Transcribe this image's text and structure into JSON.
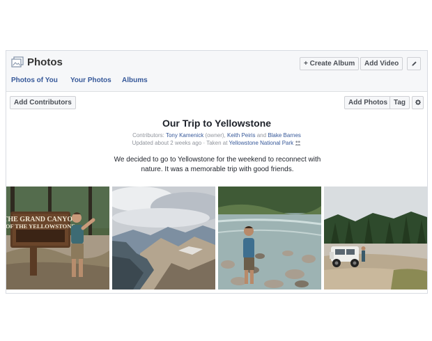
{
  "header": {
    "title": "Photos",
    "create_album_label": "+ Create Album",
    "add_video_label": "Add Video",
    "edit_icon": "pencil-icon",
    "title_icon": "photos-icon"
  },
  "tabs": [
    {
      "label": "Photos of You"
    },
    {
      "label": "Your Photos"
    },
    {
      "label": "Albums"
    }
  ],
  "toolbar": {
    "add_contributors_label": "Add Contributors",
    "add_photos_label": "Add Photos",
    "tag_label": "Tag",
    "settings_icon": "gear-icon"
  },
  "album": {
    "title": "Our Trip to Yellowstone",
    "contributors_prefix": "Contributors:",
    "contributor_1": "Tony Kamenick",
    "owner_note": "(owner),",
    "contributor_2": "Keith Peiris",
    "and_word": "and",
    "contributor_3": "Blake Barnes",
    "updated_text": "Updated about 2 weeks ago · Taken at",
    "location": "Yellowstone National Park",
    "description": "We decided to go to Yellowstone for the weekend to reconnect with nature. It was a memorable trip with good friends."
  },
  "photos": [
    {
      "sign_line_1": "THE GRAND CANYON",
      "sign_line_2": "OF THE YELLOWSTONE"
    },
    {},
    {},
    {}
  ],
  "colors": {
    "link": "#365899",
    "header_bg": "#f6f7f9",
    "border": "#d8dbe2"
  }
}
